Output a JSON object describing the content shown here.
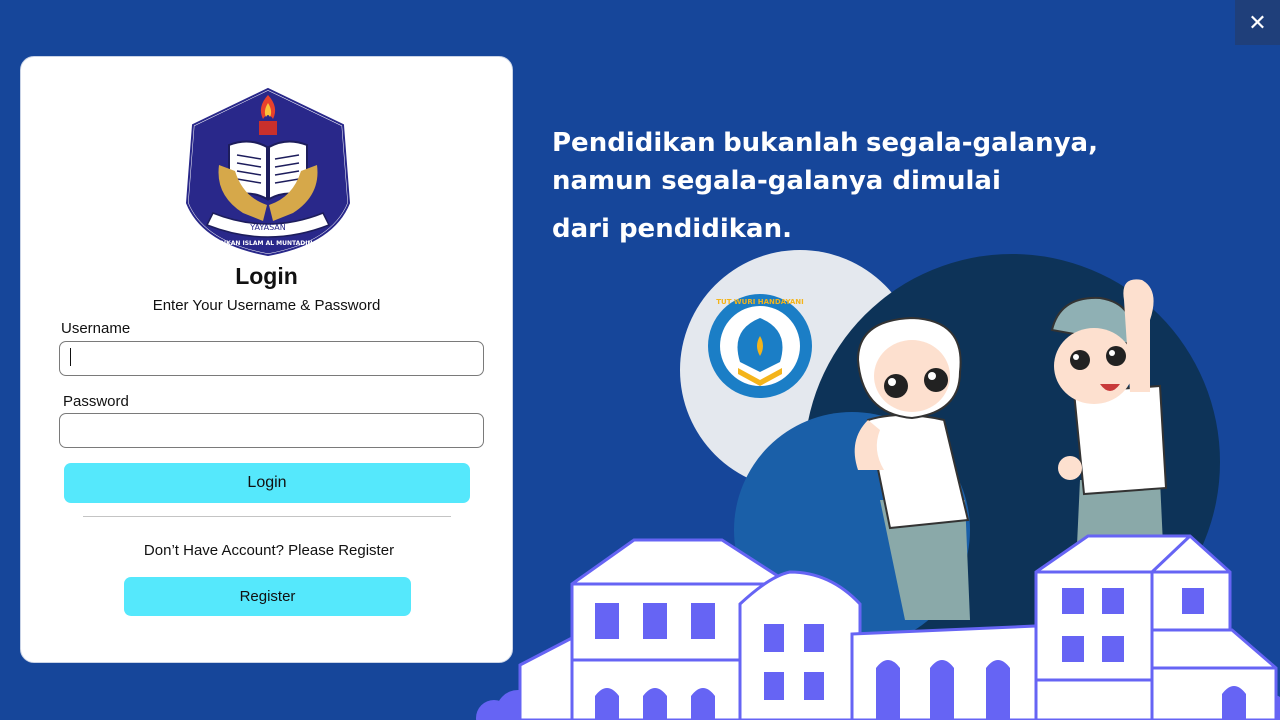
{
  "window": {
    "close_label": "✕"
  },
  "login_card": {
    "logo": {
      "text_top": "YAYASAN",
      "text_bottom": "PENDIDIKAN ISLAM AL MUNTADIN DEPOK"
    },
    "title": "Login",
    "subtitle": "Enter Your Username & Password",
    "username_label": "Username",
    "username_value": "",
    "password_label": "Password",
    "password_value": "",
    "login_button": "Login",
    "register_prompt": "Don’t Have Account? Please Register",
    "register_button": "Register"
  },
  "hero": {
    "quote_line1_words": [
      "Pendidikan",
      "bukanlah",
      "segala-galanya,"
    ],
    "quote_line2": "namun segala-galanya dimulai",
    "quote_line3": "dari pendidikan.",
    "badge_text": "TUT WURI HANDAYANI"
  },
  "colors": {
    "background": "#16469a",
    "accent_button": "#55e8fc",
    "building_accent": "#6664f4"
  }
}
